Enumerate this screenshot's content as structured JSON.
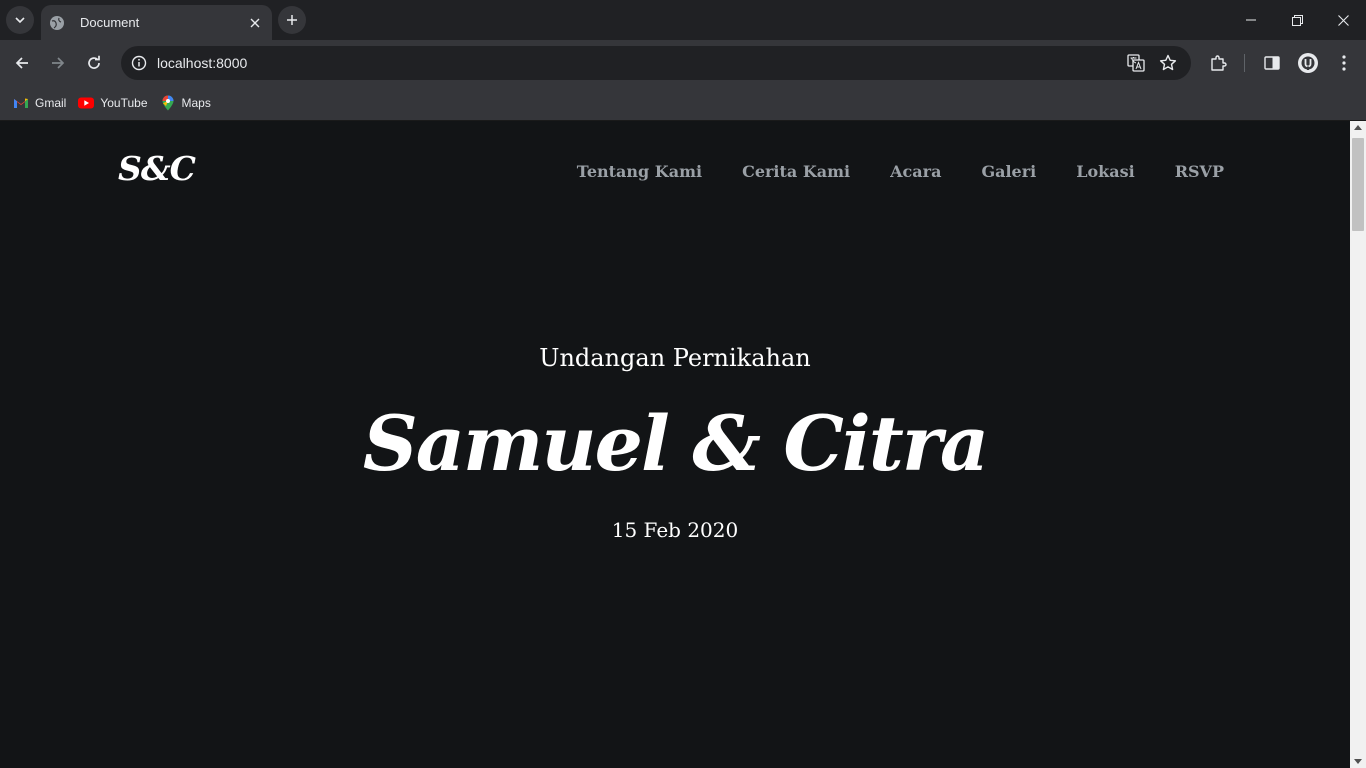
{
  "browser": {
    "tab": {
      "title": "Document"
    },
    "address_bar": {
      "url": "localhost:8000"
    },
    "bookmarks": [
      {
        "label": "Gmail",
        "icon": "gmail-icon"
      },
      {
        "label": "YouTube",
        "icon": "youtube-icon"
      },
      {
        "label": "Maps",
        "icon": "maps-icon"
      }
    ]
  },
  "page": {
    "logo": "S&C",
    "nav": [
      "Tentang Kami",
      "Cerita Kami",
      "Acara",
      "Galeri",
      "Lokasi",
      "RSVP"
    ],
    "hero": {
      "subtitle": "Undangan Pernikahan",
      "names": "Samuel & Citra",
      "date": "15 Feb 2020"
    }
  },
  "colors": {
    "page_background": "#121416",
    "chrome_background": "#202124",
    "toolbar_background": "#35363a",
    "nav_text": "#9aa0a6",
    "hero_text": "#ffffff"
  }
}
